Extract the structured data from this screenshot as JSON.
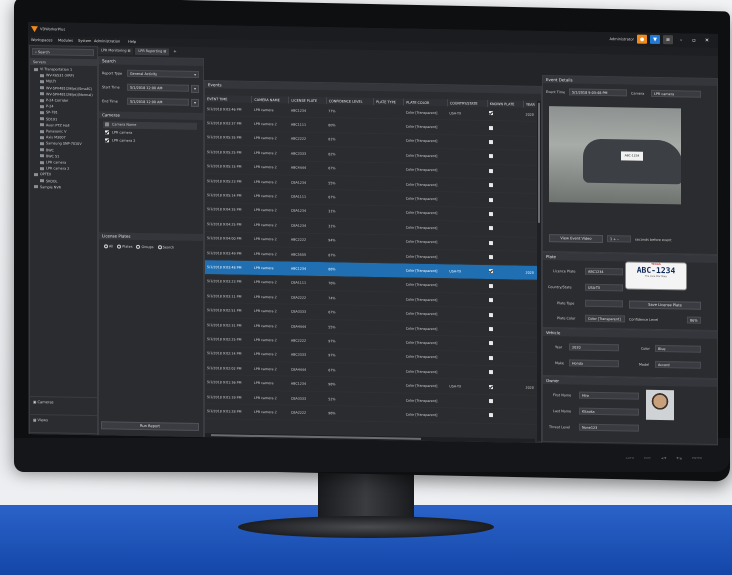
{
  "app": {
    "title": "VDWorkerPlus",
    "user": "Administrator",
    "menu": [
      "Workspaces",
      "Modules",
      "System",
      "Administration",
      "Help"
    ],
    "tabs": [
      "LPR Monitoring",
      "LPR Reporting"
    ],
    "colors": {
      "accent": "#f08a1a",
      "selection": "#1f6fb2",
      "filter": "#1e7ad6"
    }
  },
  "left_nav": {
    "search_placeholder": "Search",
    "root": "Servers",
    "tree": [
      "VI Transportation 1",
      "WV-X6531 (VRP)",
      "MULTI",
      "WV-SPV481(29fps)(SmallC)",
      "WV-SPV481(29fps)(Normal)",
      "P-24 Corridor",
      "P-24",
      "SP-781",
      "SD191",
      "Avon PTZ Hall",
      "Panasonic V",
      "Axis M3007",
      "Samsung SNP-7010V",
      "BWC",
      "BWC 51",
      "LPR camera",
      "LPR camera 2",
      "OPTEX",
      "SKOOL",
      "Sample NVR"
    ],
    "bottom": [
      "Cameras",
      "Views",
      "Maps"
    ]
  },
  "search_panel": {
    "title": "Search",
    "report_type_label": "Report Type",
    "report_type_value": "General Activity",
    "start_label": "Start Time",
    "start_value": "5/1/2018 12:00 AM",
    "end_label": "End Time",
    "end_value": "5/1/2018 12:00 AM",
    "cameras_title": "Cameras",
    "camera_name_header": "Camera Name",
    "cameras": [
      "LPR camera",
      "LPR camera 2"
    ],
    "plates_title": "License Plates",
    "plate_options": [
      "All",
      "Plates",
      "Groups",
      "Search"
    ],
    "run_report": "Run Report"
  },
  "events": {
    "title": "Events",
    "columns": [
      "EVENT TIME",
      "CAMERA NAME",
      "LICENSE PLATE",
      "CONFIDENCE LEVEL",
      "PLATE TYPE",
      "PLATE COLOR",
      "COUNTRY/STATE",
      "KNOWN PLATE",
      "YEAR"
    ],
    "rows": [
      [
        "5/1/2018 9:03:46 PM",
        "LPR camera",
        "ABC1234",
        "77%",
        "",
        "Color [Transparent]",
        "USA-TX",
        true,
        "2020"
      ],
      [
        "5/1/2018 9:03:37 PM",
        "LPR camera 2",
        "ABC1111",
        "80%",
        "",
        "Color [Transparent]",
        "",
        false,
        ""
      ],
      [
        "5/1/2018 9:05:35 PM",
        "LPR camera 2",
        "ABC2222",
        "81%",
        "",
        "Color [Transparent]",
        "",
        false,
        ""
      ],
      [
        "5/1/2018 9:05:25 PM",
        "LPR camera 2",
        "ABC3333",
        "82%",
        "",
        "Color [Transparent]",
        "",
        false,
        ""
      ],
      [
        "5/1/2018 9:05:15 PM",
        "LPR camera 2",
        "ABC4444",
        "67%",
        "",
        "Color [Transparent]",
        "",
        false,
        ""
      ],
      [
        "5/1/2018 9:05:23 PM",
        "LPR camera 2",
        "CBA1234",
        "55%",
        "",
        "Color [Transparent]",
        "",
        false,
        ""
      ],
      [
        "5/1/2018 9:05:14 PM",
        "LPR camera 2",
        "CBA1111",
        "67%",
        "",
        "Color [Transparent]",
        "",
        false,
        ""
      ],
      [
        "5/1/2018 9:04:35 PM",
        "LPR camera 2",
        "CBA1234",
        "31%",
        "",
        "Color [Transparent]",
        "",
        false,
        ""
      ],
      [
        "5/1/2018 9:04:25 PM",
        "LPR camera 2",
        "CBA1234",
        "31%",
        "",
        "Color [Transparent]",
        "",
        false,
        ""
      ],
      [
        "5/1/2018 9:04:00 PM",
        "LPR camera 2",
        "ABC2222",
        "94%",
        "",
        "Color [Transparent]",
        "",
        false,
        ""
      ],
      [
        "5/1/2018 9:03:49 PM",
        "LPR camera 2",
        "ABC5555",
        "87%",
        "",
        "Color [Transparent]",
        "",
        false,
        ""
      ],
      [
        "5/1/2018 9:03:48 PM",
        "LPR camera",
        "ABC1234",
        "86%",
        "",
        "Color [Transparent]",
        "USA-TX",
        true,
        "2020"
      ],
      [
        "5/1/2018 9:03:23 PM",
        "LPR camera 2",
        "CBA1111",
        "76%",
        "",
        "Color [Transparent]",
        "",
        false,
        ""
      ],
      [
        "5/1/2018 9:03:11 PM",
        "LPR camera 2",
        "CBA2222",
        "74%",
        "",
        "Color [Transparent]",
        "",
        false,
        ""
      ],
      [
        "5/1/2018 9:02:51 PM",
        "LPR camera 2",
        "CBA3333",
        "67%",
        "",
        "Color [Transparent]",
        "",
        false,
        ""
      ],
      [
        "5/1/2018 9:02:31 PM",
        "LPR camera 2",
        "CBA4444",
        "55%",
        "",
        "Color [Transparent]",
        "",
        false,
        ""
      ],
      [
        "5/1/2018 9:02:25 PM",
        "LPR camera 2",
        "ABC2222",
        "97%",
        "",
        "Color [Transparent]",
        "",
        false,
        ""
      ],
      [
        "5/1/2018 9:02:14 PM",
        "LPR camera 2",
        "ABC3333",
        "97%",
        "",
        "Color [Transparent]",
        "",
        false,
        ""
      ],
      [
        "5/1/2018 9:02:02 PM",
        "LPR camera 2",
        "CBA4444",
        "67%",
        "",
        "Color [Transparent]",
        "",
        false,
        ""
      ],
      [
        "5/1/2018 9:01:36 PM",
        "LPR camera",
        "ABC1234",
        "98%",
        "",
        "Color [Transparent]",
        "USA-TX",
        true,
        "2020"
      ],
      [
        "5/1/2018 9:01:19 PM",
        "LPR camera 2",
        "CBA3333",
        "52%",
        "",
        "Color [Transparent]",
        "",
        false,
        ""
      ],
      [
        "5/1/2018 9:01:28 PM",
        "LPR camera 2",
        "CBA2222",
        "96%",
        "",
        "Color [Transparent]",
        "",
        false,
        ""
      ]
    ],
    "selected_index": 11
  },
  "event_details": {
    "title": "Event Details",
    "event_time_label": "Event Time",
    "event_time_value": "5/1/2018 9:03:48 PM",
    "camera_label": "Camera",
    "camera_value": "LPR camera",
    "view_video": "View Event Video",
    "seconds_value": "1",
    "seconds_label": "seconds before event",
    "car_plate": "ABC-1234"
  },
  "plate": {
    "title": "Plate",
    "license_label": "Licence Plate",
    "license_value": "ABC1234",
    "country_label": "Country/State",
    "country_value": "USA-TX",
    "type_label": "Plate Type",
    "type_value": "",
    "color_label": "Plate Color",
    "color_value": "Color [Transparent]",
    "confidence_label": "Confidence Level",
    "confidence_value": "86%",
    "save": "Save License Plate",
    "plate_image_text": "ABC-1234",
    "plate_image_state": "TEXAS",
    "plate_image_sub": "The Lone Star State"
  },
  "vehicle": {
    "title": "Vehicle",
    "year_label": "Year",
    "year_value": "2020",
    "color_label": "Color",
    "color_value": "Blue",
    "make_label": "Make",
    "make_value": "Honda",
    "model_label": "Model",
    "model_value": "Accord"
  },
  "owner": {
    "title": "Owner",
    "first_label": "First Name",
    "first_value": "Hiro",
    "last_label": "Last Name",
    "last_value": "Kitaoka",
    "threat_label": "Threat Level",
    "threat_value": "None123"
  },
  "chin_buttons": [
    "AUTO",
    "EXIT",
    "◄/▼",
    "▼/▲",
    "ENTER"
  ]
}
